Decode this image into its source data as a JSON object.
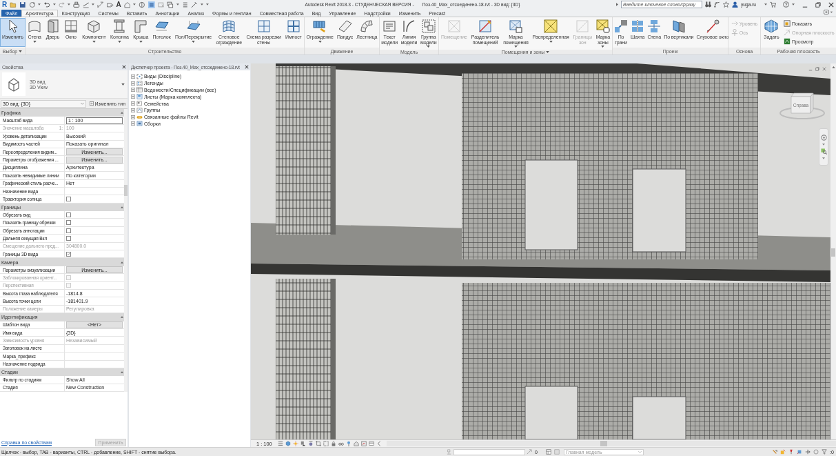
{
  "title_bar": {
    "logo": "R",
    "text_tool_glyph": "A",
    "title": "Autodesk Revit 2018.3 - СТУДЕНЧЕСКАЯ ВЕРСИЯ -",
    "document": "Поз.40_Max_отсоединено-18.rvt - 3D вид: {3D}",
    "search": {
      "placeholder": "Введите ключевое слово/фразу"
    },
    "user": "yuga.ru"
  },
  "tabs": [
    {
      "label": "Файл",
      "kind": "file",
      "selected": false
    },
    {
      "label": "Архитектура",
      "kind": "tab",
      "selected": true
    },
    {
      "label": "Конструкция",
      "kind": "tab",
      "selected": false
    },
    {
      "label": "Системы",
      "kind": "tab",
      "selected": false
    },
    {
      "label": "Вставить",
      "kind": "tab",
      "selected": false
    },
    {
      "label": "Аннотации",
      "kind": "tab",
      "selected": false
    },
    {
      "label": "Анализ",
      "kind": "tab",
      "selected": false
    },
    {
      "label": "Формы и генплан",
      "kind": "tab",
      "selected": false
    },
    {
      "label": "Совместная работа",
      "kind": "tab",
      "selected": false
    },
    {
      "label": "Вид",
      "kind": "tab",
      "selected": false
    },
    {
      "label": "Управление",
      "kind": "tab",
      "selected": false
    },
    {
      "label": "Надстройки",
      "kind": "tab",
      "selected": false
    },
    {
      "label": "Изменить",
      "kind": "tab",
      "selected": false
    },
    {
      "label": "Precast",
      "kind": "tab",
      "selected": false
    }
  ],
  "ribbon": [
    {
      "label": "Выбор",
      "menu": true,
      "buttons": [
        {
          "label": "Изменить",
          "kind": "large",
          "selected": true,
          "disabled": false,
          "dropdown": false
        }
      ]
    },
    {
      "label": "Строительство",
      "menu": false,
      "buttons": [
        {
          "label": "Стена",
          "kind": "large",
          "selected": false,
          "disabled": false,
          "dropdown": true
        },
        {
          "label": "Дверь",
          "kind": "large",
          "selected": false,
          "disabled": false,
          "dropdown": false
        },
        {
          "label": "Окно",
          "kind": "large",
          "selected": false,
          "disabled": false,
          "dropdown": false
        },
        {
          "label": "Компонент",
          "kind": "large",
          "selected": false,
          "disabled": false,
          "dropdown": true
        },
        {
          "label": "Колонна",
          "kind": "large",
          "selected": false,
          "disabled": false,
          "dropdown": true
        },
        {
          "label": "Крыша",
          "kind": "large",
          "selected": false,
          "disabled": false,
          "dropdown": true
        },
        {
          "label": "Потолок",
          "kind": "large",
          "selected": false,
          "disabled": false,
          "dropdown": false
        },
        {
          "label": "Пол/Перекрытие",
          "kind": "large",
          "selected": false,
          "disabled": false,
          "dropdown": true
        },
        {
          "label": "Стеновое\nограждение",
          "kind": "large",
          "selected": false,
          "disabled": false,
          "dropdown": false
        },
        {
          "label": "Схема разрезки\nстены",
          "kind": "large",
          "selected": false,
          "disabled": false,
          "dropdown": false
        },
        {
          "label": "Импост",
          "kind": "large",
          "selected": false,
          "disabled": false,
          "dropdown": false
        }
      ]
    },
    {
      "label": "Движение",
      "menu": false,
      "buttons": [
        {
          "label": "Ограждение",
          "kind": "large",
          "selected": false,
          "disabled": false,
          "dropdown": true
        },
        {
          "label": "Пандус",
          "kind": "large",
          "selected": false,
          "disabled": false,
          "dropdown": false
        },
        {
          "label": "Лестница",
          "kind": "large",
          "selected": false,
          "disabled": false,
          "dropdown": false
        }
      ]
    },
    {
      "label": "Модель",
      "menu": false,
      "buttons": [
        {
          "label": "Текст\nмодели",
          "kind": "large",
          "selected": false,
          "disabled": false,
          "dropdown": false
        },
        {
          "label": "Линия\nмодели",
          "kind": "large",
          "selected": false,
          "disabled": false,
          "dropdown": false
        },
        {
          "label": "Группа\nмодели",
          "kind": "large",
          "selected": false,
          "disabled": false,
          "dropdown": true
        }
      ]
    },
    {
      "label": "Помещения и зоны",
      "menu": true,
      "buttons": [
        {
          "label": "Помещение",
          "kind": "large",
          "selected": false,
          "disabled": true,
          "dropdown": false
        },
        {
          "label": "Разделитель\nпомещений",
          "kind": "large",
          "selected": false,
          "disabled": false,
          "dropdown": false
        },
        {
          "label": "Марка\nпомещения",
          "kind": "large",
          "selected": false,
          "disabled": false,
          "dropdown": true
        },
        {
          "label": "Распределенная",
          "kind": "large",
          "selected": false,
          "disabled": false,
          "dropdown": true
        },
        {
          "label": "Границы\nзон",
          "kind": "large",
          "selected": false,
          "disabled": true,
          "dropdown": false
        },
        {
          "label": "Марка\nзоны",
          "kind": "large",
          "selected": false,
          "disabled": false,
          "dropdown": true
        }
      ]
    },
    {
      "label": "Проем",
      "menu": false,
      "buttons": [
        {
          "label": "По\nграни",
          "kind": "large",
          "selected": false,
          "disabled": false,
          "dropdown": false
        },
        {
          "label": "Шахта",
          "kind": "large",
          "selected": false,
          "disabled": false,
          "dropdown": false
        },
        {
          "label": "Стена",
          "kind": "large",
          "selected": false,
          "disabled": false,
          "dropdown": false
        },
        {
          "label": "По вертикали",
          "kind": "large",
          "selected": false,
          "disabled": false,
          "dropdown": false
        },
        {
          "label": "Слуховое окно",
          "kind": "large",
          "selected": false,
          "disabled": false,
          "dropdown": false
        }
      ]
    },
    {
      "label": "Основа",
      "menu": false,
      "buttons": [
        {
          "label": "Уровень",
          "kind": "small",
          "selected": false,
          "disabled": true,
          "dropdown": false
        },
        {
          "label": "Ось",
          "kind": "small",
          "selected": false,
          "disabled": true,
          "dropdown": false
        }
      ]
    },
    {
      "label": "Рабочая плоскость",
      "menu": false,
      "buttons": [
        {
          "label": "Задать",
          "kind": "large",
          "selected": false,
          "disabled": false,
          "dropdown": false
        },
        {
          "label": "Показать",
          "kind": "small",
          "selected": false,
          "disabled": false,
          "dropdown": false
        },
        {
          "label": "Опорная плоскость",
          "kind": "small",
          "selected": false,
          "disabled": true,
          "dropdown": false
        },
        {
          "label": "Просмотр",
          "kind": "small",
          "selected": false,
          "disabled": false,
          "dropdown": false
        }
      ]
    }
  ],
  "properties": {
    "title": "Свойства",
    "type": {
      "name": "3D вид",
      "subname": "3D View"
    },
    "selector": "3D вид: {3D}",
    "edit_type": "Изменить тип",
    "groups": [
      {
        "title": "Графика",
        "expanded": true,
        "rows": [
          {
            "label": "Масштаб вида",
            "kind": "input",
            "value": "1 : 100",
            "disabled": false
          },
          {
            "label": "Значение масштаба",
            "suffix": "1:",
            "kind": "text",
            "value": "100",
            "disabled": true
          },
          {
            "label": "Уровень детализации",
            "kind": "text",
            "value": "Высокий",
            "disabled": false
          },
          {
            "label": "Видимость частей",
            "kind": "text",
            "value": "Показать оригинал",
            "disabled": false
          },
          {
            "label": "Переопределения видим...",
            "kind": "button",
            "value": "Изменить...",
            "disabled": false
          },
          {
            "label": "Параметры отображения ...",
            "kind": "button",
            "value": "Изменить...",
            "disabled": false
          },
          {
            "label": "Дисциплина",
            "kind": "text",
            "value": "Архитектура",
            "disabled": false
          },
          {
            "label": "Показать невидимые линии",
            "kind": "text",
            "value": "По категории",
            "disabled": false
          },
          {
            "label": "Графический стиль расче...",
            "kind": "text",
            "value": "Нет",
            "disabled": false
          },
          {
            "label": "Назначение вида",
            "kind": "text",
            "disabled": false
          },
          {
            "label": "Траектория солнца",
            "kind": "checkbox",
            "checked": false,
            "disabled": false
          }
        ]
      },
      {
        "title": "Границы",
        "expanded": true,
        "rows": [
          {
            "label": "Обрезать вид",
            "kind": "checkbox",
            "checked": false,
            "disabled": false
          },
          {
            "label": "Показать границу обрезки",
            "kind": "checkbox",
            "checked": false,
            "disabled": false
          },
          {
            "label": "Обрезать аннотации",
            "kind": "checkbox",
            "checked": false,
            "disabled": false
          },
          {
            "label": "Дальняя секущая Вкл",
            "kind": "checkbox",
            "checked": false,
            "disabled": false
          },
          {
            "label": "Смещение дальнего пред...",
            "kind": "text",
            "value": "304800.0",
            "disabled": true
          },
          {
            "label": "Границы 3D вида",
            "kind": "checkbox",
            "checked": true,
            "disabled": false
          }
        ]
      },
      {
        "title": "Камера",
        "expanded": true,
        "rows": [
          {
            "label": "Параметры визуализации",
            "kind": "button",
            "value": "Изменить...",
            "disabled": false
          },
          {
            "label": "Заблокированная ориент...",
            "kind": "checkbox",
            "checked": false,
            "disabled": true
          },
          {
            "label": "Перспективная",
            "kind": "checkbox",
            "checked": false,
            "disabled": true
          },
          {
            "label": "Высота глаза наблюдателя",
            "kind": "text",
            "value": "-1814.8",
            "disabled": false
          },
          {
            "label": "Высота точки цели",
            "kind": "text",
            "value": "-181401.9",
            "disabled": false
          },
          {
            "label": "Положение камеры",
            "kind": "text",
            "value": "Регулировка",
            "disabled": true
          }
        ]
      },
      {
        "title": "Идентификация",
        "expanded": true,
        "rows": [
          {
            "label": "Шаблон вида",
            "kind": "button",
            "value": "<Нет>",
            "disabled": false
          },
          {
            "label": "Имя вида",
            "kind": "text",
            "value": "{3D}",
            "disabled": false
          },
          {
            "label": "Зависимость уровня",
            "kind": "text",
            "value": "Независимый",
            "disabled": true
          },
          {
            "label": "Заголовок на листе",
            "kind": "text",
            "disabled": false
          },
          {
            "label": "Марка_префикс",
            "kind": "text",
            "disabled": false
          },
          {
            "label": "Назначение подвида",
            "kind": "text",
            "disabled": false
          }
        ]
      },
      {
        "title": "Стадии",
        "expanded": true,
        "rows": [
          {
            "label": "Фильтр по стадиям",
            "kind": "text",
            "value": "Show All",
            "disabled": false
          },
          {
            "label": "Стадия",
            "kind": "text",
            "value": "New Construction",
            "disabled": false
          }
        ]
      }
    ],
    "help_link": "Справка по свойствам",
    "apply": {
      "label": "Применить",
      "disabled": true
    }
  },
  "project_browser": {
    "title": "Диспетчер проекта - Поз.40_Max_отсоединено-18.rvt",
    "items": [
      {
        "label": "Виды (Discipline)",
        "expanded": false
      },
      {
        "label": "Легенды",
        "expanded": false
      },
      {
        "label": "Ведомости/Спецификации (все)",
        "expanded": false
      },
      {
        "label": "Листы (Марка комплекта)",
        "expanded": false
      },
      {
        "label": "Семейства",
        "expanded": false
      },
      {
        "label": "Группы",
        "expanded": false
      },
      {
        "label": "Связанные файлы Revit",
        "expanded": false
      },
      {
        "label": "Сборки",
        "expanded": false
      }
    ]
  },
  "viewport": {
    "view_cube_face": "Справа"
  },
  "view_bar": {
    "scale": "1 : 100"
  },
  "status_bar": {
    "message": "Щелчок - выбор, TAB - варианты, CTRL - добавление, SHIFT - снятие выбора.",
    "editable_count": "0",
    "model": "Главная модель",
    "filter_count": ":0"
  }
}
